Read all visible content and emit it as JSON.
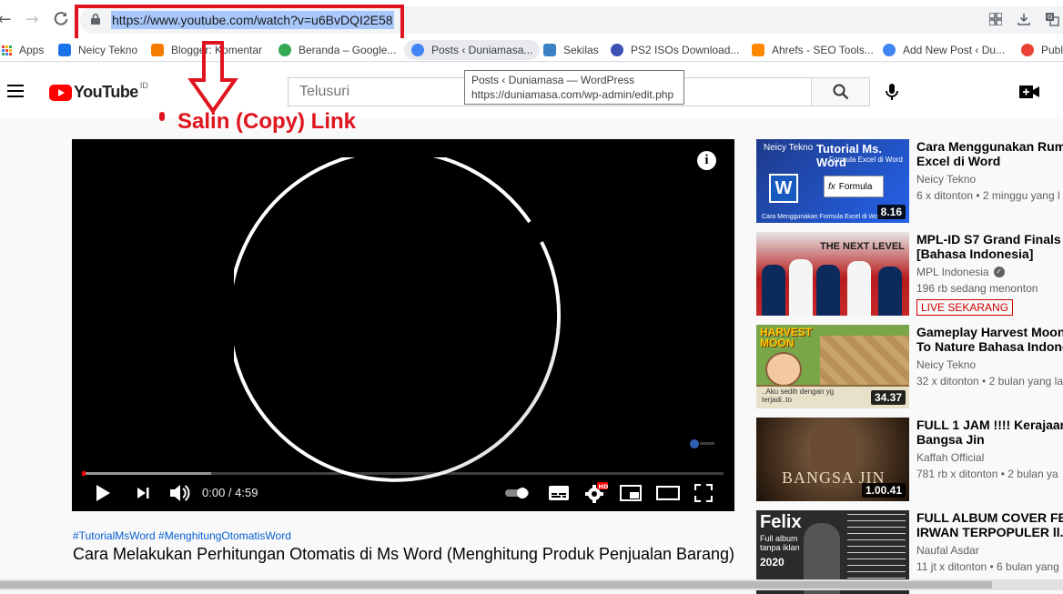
{
  "browser": {
    "url": "https://www.youtube.com/watch?v=u6BvDQI2E58",
    "bookmarks": [
      {
        "label": "Apps",
        "color": "#5f6368"
      },
      {
        "label": "Neicy Tekno",
        "color": "#1a73e8"
      },
      {
        "label": "Blogger: Komentar",
        "color": "#f57c00"
      },
      {
        "label": "Beranda – Google...",
        "color": "#34a853"
      },
      {
        "label": "Posts ‹ Duniamasa...",
        "color": "#4285f4"
      },
      {
        "label": "Sekilas",
        "color": "#3b82c4"
      },
      {
        "label": "PS2 ISOs Download...",
        "color": "#3f51b5"
      },
      {
        "label": "Ahrefs - SEO Tools...",
        "color": "#ff8800"
      },
      {
        "label": "Add New Post ‹ Du...",
        "color": "#4285f4"
      },
      {
        "label": "Publ",
        "color": "#ea4335"
      }
    ]
  },
  "tooltip": {
    "line1": "Posts ‹ Duniamasa — WordPress",
    "line2": "https://duniamasa.com/wp-admin/edit.php"
  },
  "annotation": {
    "text": "Salin (Copy) Link",
    "color": "#e0141e"
  },
  "youtube": {
    "logo_text": "YouTube",
    "country_code": "ID",
    "search_placeholder": "Telusuri"
  },
  "player": {
    "time": "0:00 / 4:59",
    "loaded_fraction": 0.2,
    "info_label": "i"
  },
  "video": {
    "hashtags": "#TutorialMsWord #MenghitungOtomatisWord",
    "title": "Cara Melakukan Perhitungan Otomatis di Ms Word (Menghitung Produk Penjualan Barang)"
  },
  "recommendations": [
    {
      "title_line1": "Cara Menggunakan Rumu",
      "title_line2": "Excel di Word",
      "channel": "Neicy Tekno",
      "meta": "6 x ditonton • 2 minggu yang l",
      "duration": "8.16",
      "thumb_text1": "Neicy Tekno",
      "thumb_text2": "Tutorial Ms. Word",
      "thumb_text3": "Formula Excel di Word",
      "thumb_text4": "Formula",
      "thumb_text5": "Cara Menggunakan Formula Excel di Word",
      "thumb_color": "#1e3a8a"
    },
    {
      "title_line1": "MPL-ID S7 Grand Finals D",
      "title_line2": "[Bahasa Indonesia]",
      "channel": "MPL Indonesia",
      "meta": "196 rb sedang menonton",
      "live": "LIVE SEKARANG",
      "thumb_text1": "THE NEXT LEVEL",
      "thumb_color": "#c62828"
    },
    {
      "title_line1": "Gameplay Harvest Moon :",
      "title_line2": "To Nature Bahasa Indones",
      "channel": "Neicy Tekno",
      "meta": "32 x ditonton • 2 bulan yang la",
      "duration": "34.37",
      "thumb_text1": "HARVEST MOON",
      "thumb_text2": "..Aku sedih dengan yg terjadi..to",
      "thumb_color": "#c98a2e"
    },
    {
      "title_line1": "FULL 1 JAM !!!! Kerajaan",
      "title_line2": "Bangsa Jin",
      "channel": "Kaffah Official",
      "meta": "781 rb x ditonton • 2 bulan ya",
      "duration": "1.00.41",
      "thumb_text1": "BANGSA JIN",
      "thumb_color": "#3e2a1a"
    },
    {
      "title_line1": "FULL ALBUM COVER FELI",
      "title_line2": "IRWAN TERPOPULER ll...",
      "channel": "Naufal Asdar",
      "meta": "11 jt x ditonton • 6 bulan yang",
      "thumb_text1": "Felix",
      "thumb_text2": "Full album tanpa iklan",
      "thumb_text3": "2020",
      "thumb_color": "#2b2b2b"
    }
  ]
}
